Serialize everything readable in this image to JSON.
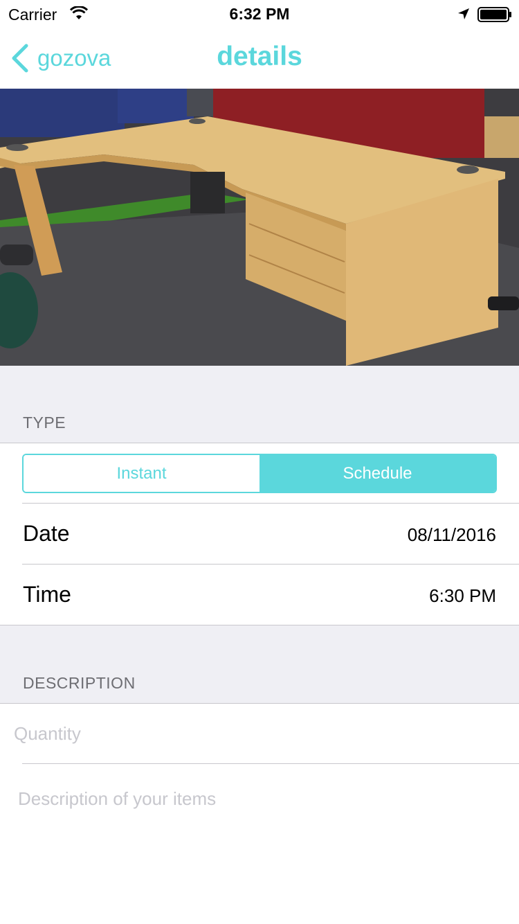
{
  "status_bar": {
    "carrier": "Carrier",
    "time": "6:32 PM",
    "icons": [
      "wifi-icon",
      "location-arrow-icon",
      "battery-icon"
    ]
  },
  "nav": {
    "back_label": "gozova",
    "title": "details",
    "accent_color": "#5bd7dc"
  },
  "photo": {
    "subject": "office-desk-photo"
  },
  "type_section": {
    "header": "TYPE",
    "segments": [
      "Instant",
      "Schedule"
    ],
    "selected": "Schedule"
  },
  "schedule": {
    "date_label": "Date",
    "date_value": "08/11/2016",
    "time_label": "Time",
    "time_value": "6:30 PM"
  },
  "description_section": {
    "header": "DESCRIPTION",
    "quantity_placeholder": "Quantity",
    "quantity_value": "",
    "description_placeholder": "Description of your items",
    "description_value": ""
  },
  "colors": {
    "accent": "#5bd7dc",
    "group_background": "#efeff4",
    "separator": "#c8c7cc",
    "placeholder": "#c7c7cd"
  }
}
